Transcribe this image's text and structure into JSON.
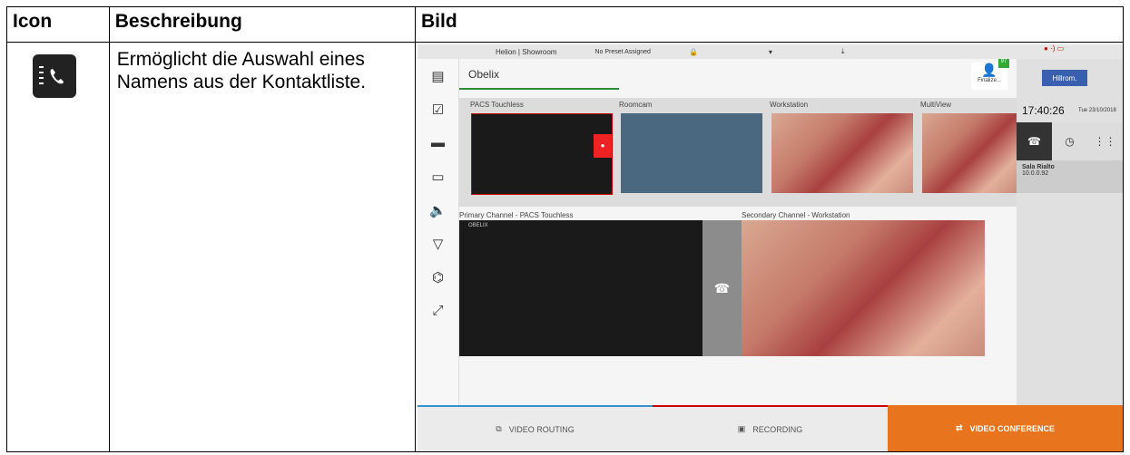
{
  "headers": {
    "icon": "Icon",
    "description": "Beschreibung",
    "image": "Bild"
  },
  "row": {
    "icon_name": "contact-book-phone-icon",
    "description": "Ermöglicht die Auswahl eines Namens aus der Kontaktliste."
  },
  "screenshot": {
    "topbar": {
      "room": "Helion | Showroom",
      "preset": "No Preset Assigned"
    },
    "patient": "Obelix",
    "finalize": "Finalize...",
    "badge": "97",
    "brand": "Hillrom.",
    "time": "17:40:26",
    "date": "Tue 23/10/2018",
    "contact": {
      "name": "Sala Rialto",
      "ip": "10.0.0.92"
    },
    "sources": [
      "PACS Touchless",
      "Roomcam",
      "Workstation",
      "MultiView"
    ],
    "primary": "Primary Channel - PACS Touchless",
    "secondary": "Secondary Channel - Workstation",
    "primary_tag": "OBELIX",
    "tabs": [
      "VIDEO ROUTING",
      "RECORDING",
      "VIDEO CONFERENCE"
    ],
    "accent": "#e8741e"
  }
}
